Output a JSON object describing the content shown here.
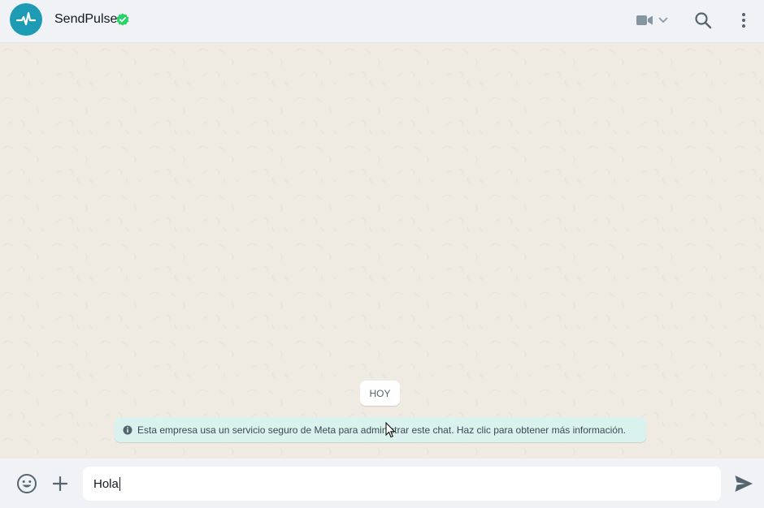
{
  "header": {
    "contact_name": "SendPulse",
    "avatar_icon": "pulse-icon",
    "verified_icon": "verified-check-icon",
    "video_icon": "video-camera-icon",
    "search_icon": "search-icon",
    "menu_icon": "kebab-menu-icon"
  },
  "chat": {
    "date_label": "HOY",
    "notice_text": "Esta empresa usa un servicio seguro de Meta para administrar este chat. Haz clic para obtener más información.",
    "notice_icon": "info-icon"
  },
  "composer": {
    "input_value": "Hola",
    "emoji_icon": "emoji-icon",
    "attach_icon": "plus-icon",
    "send_icon": "send-icon"
  },
  "colors": {
    "header_bg": "#f0f2f5",
    "chat_bg": "#efeae2",
    "avatar_bg": "#1e9bb4",
    "verified": "#25d366",
    "notice_bg": "#d9f2ed"
  }
}
